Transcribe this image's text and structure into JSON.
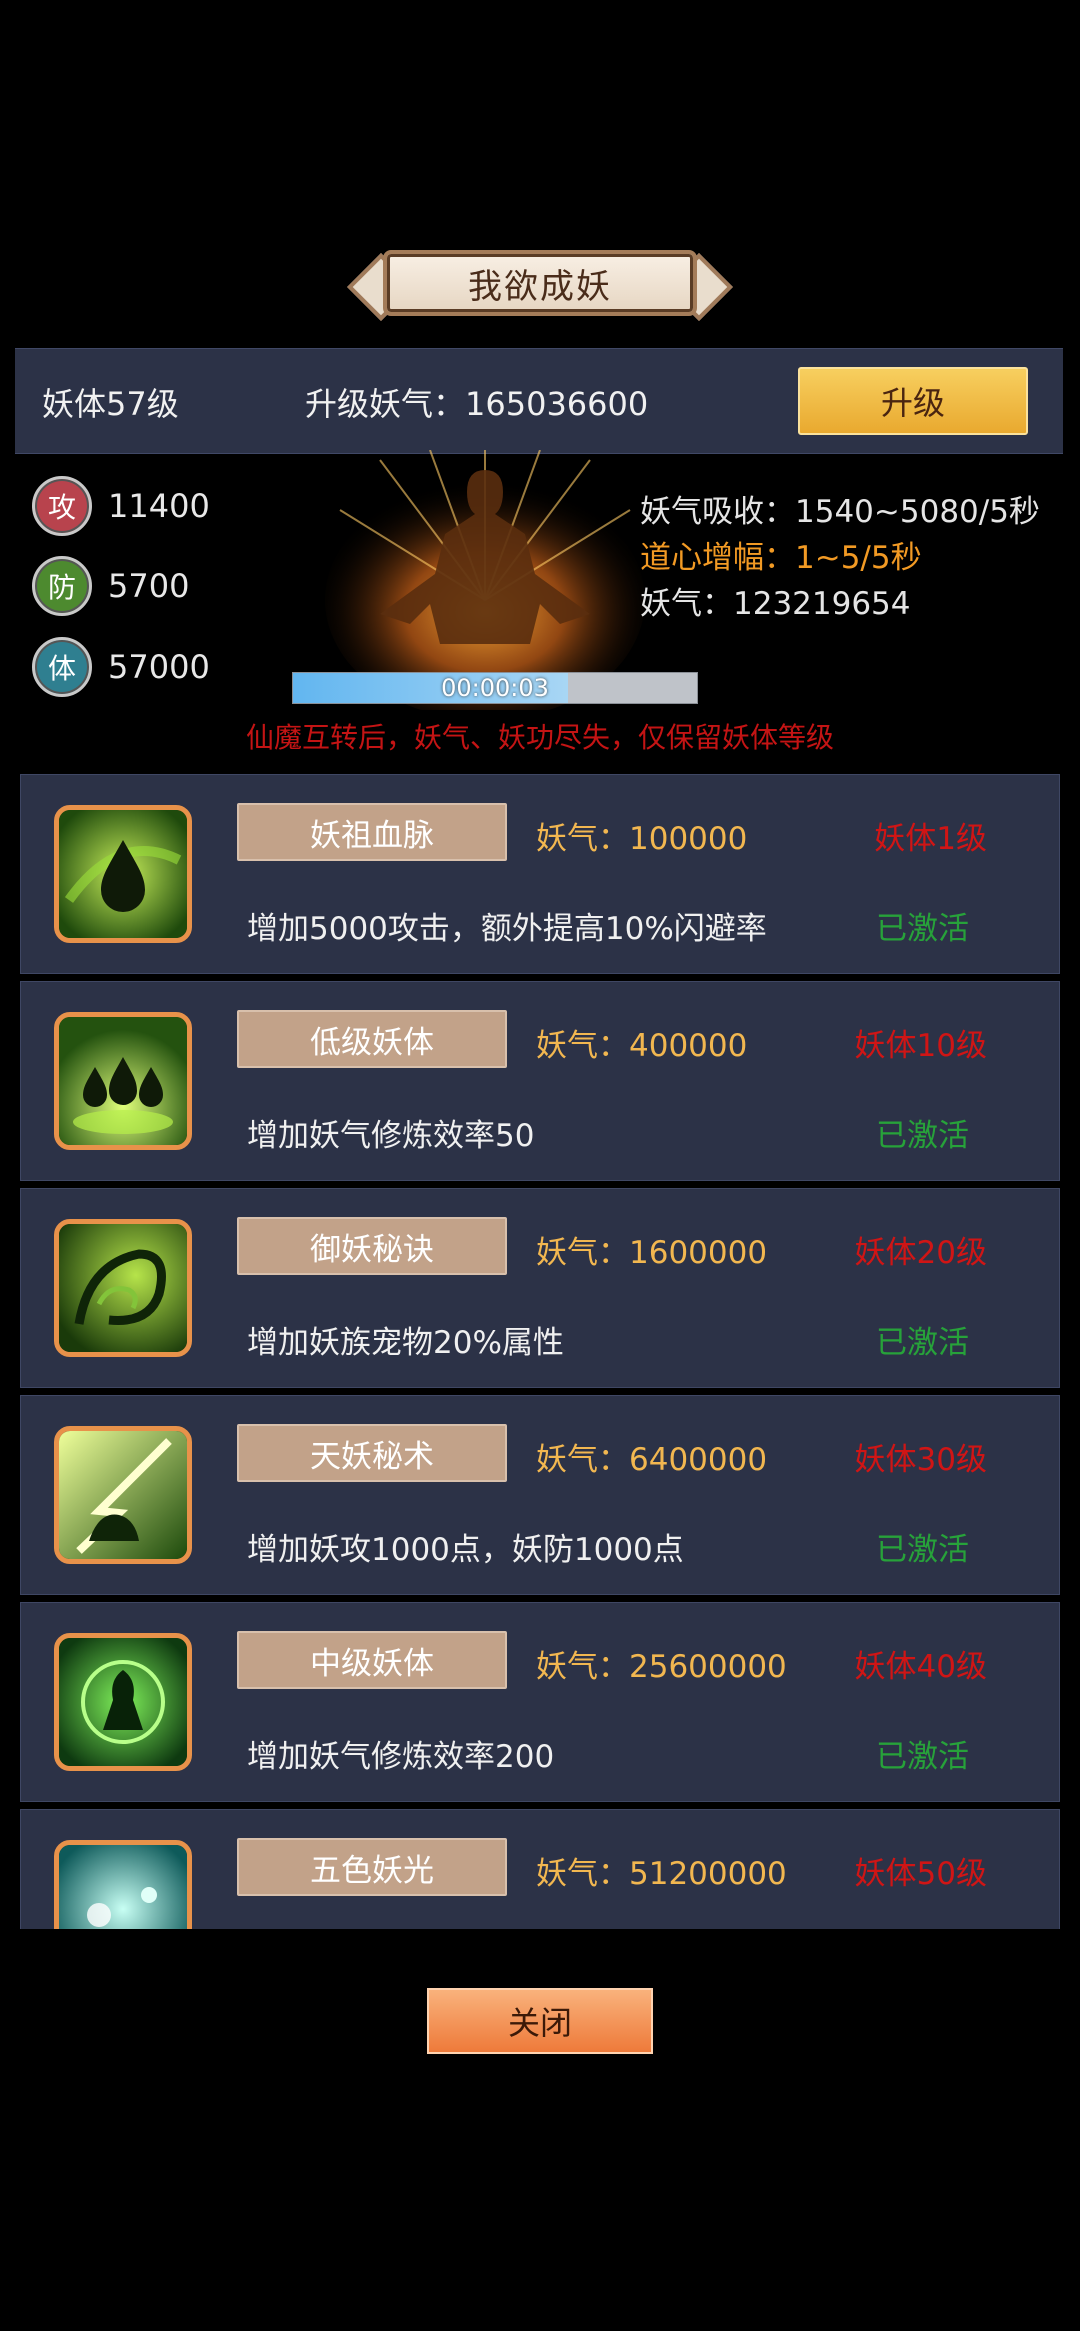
{
  "title": "我欲成妖",
  "header": {
    "level": "妖体57级",
    "upgrade_cost": "升级妖气：165036600",
    "upgrade_button": "升级"
  },
  "stats": [
    {
      "glyph": "攻",
      "value": "11400",
      "color": "#b8434d"
    },
    {
      "glyph": "防",
      "value": "5700",
      "color": "#4d8a2f"
    },
    {
      "glyph": "体",
      "value": "57000",
      "color": "#2f7f90"
    }
  ],
  "info": {
    "absorb": "妖气吸收：1540~5080/5秒",
    "boost": "道心增幅：1~5/5秒",
    "qi": "妖气：123219654"
  },
  "progress": {
    "text": "00:00:03",
    "fill": 0.68
  },
  "warning": "仙魔互转后，妖气、妖功尽失，仅保留妖体等级",
  "skills": [
    {
      "name": "妖祖血脉",
      "cost": "妖气：100000",
      "req": "妖体1级",
      "desc": "增加5000攻击，额外提高10%闪避率",
      "status": "已激活",
      "icon": "blood-drop-icon"
    },
    {
      "name": "低级妖体",
      "cost": "妖气：400000",
      "req": "妖体10级",
      "desc": "增加妖气修炼效率50",
      "status": "已激活",
      "icon": "triple-drop-icon"
    },
    {
      "name": "御妖秘诀",
      "cost": "妖气：1600000",
      "req": "妖体20级",
      "desc": "增加妖族宠物20%属性",
      "status": "已激活",
      "icon": "beast-swirl-icon"
    },
    {
      "name": "天妖秘术",
      "cost": "妖气：6400000",
      "req": "妖体30级",
      "desc": "增加妖攻1000点，妖防1000点",
      "status": "已激活",
      "icon": "lightning-beast-icon"
    },
    {
      "name": "中级妖体",
      "cost": "妖气：25600000",
      "req": "妖体40级",
      "desc": "增加妖气修炼效率200",
      "status": "已激活",
      "icon": "demon-orb-icon"
    },
    {
      "name": "五色妖光",
      "cost": "妖气：51200000",
      "req": "妖体50级",
      "desc": "",
      "status": "",
      "icon": "five-color-light-icon"
    }
  ],
  "close_button": "关闭"
}
